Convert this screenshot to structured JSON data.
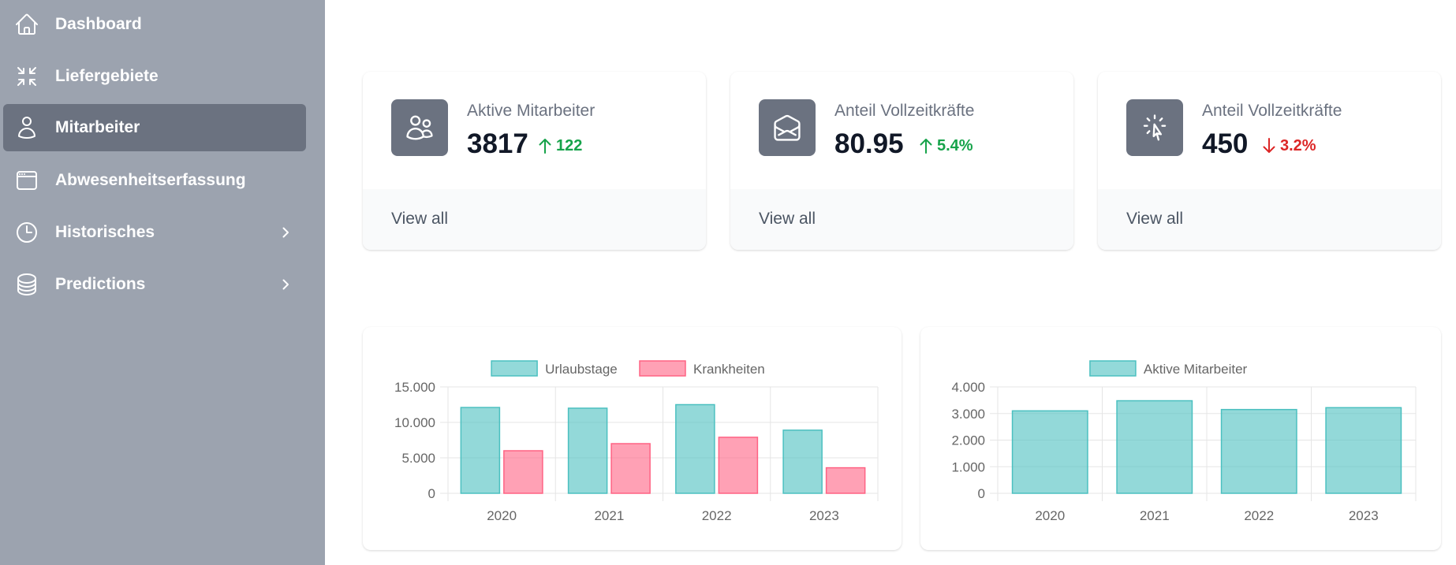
{
  "sidebar": {
    "items": [
      {
        "label": "Dashboard",
        "icon": "home-icon",
        "active": false,
        "chevron": false
      },
      {
        "label": "Liefergebiete",
        "icon": "arrows-pointing-in-icon",
        "active": false,
        "chevron": false
      },
      {
        "label": "Mitarbeiter",
        "icon": "user-icon",
        "active": true,
        "chevron": false
      },
      {
        "label": "Abwesenheitserfassung",
        "icon": "window-icon",
        "active": false,
        "chevron": false
      },
      {
        "label": "Historisches",
        "icon": "clock-icon",
        "active": false,
        "chevron": true
      },
      {
        "label": "Predictions",
        "icon": "database-icon",
        "active": false,
        "chevron": true
      }
    ]
  },
  "stats": [
    {
      "title": "Aktive Mitarbeiter",
      "value": "3817",
      "change": "122",
      "direction": "up",
      "icon": "users-icon",
      "footer": "View all"
    },
    {
      "title": "Anteil Vollzeitkräfte",
      "value": "80.95",
      "change": "5.4%",
      "direction": "up",
      "icon": "envelope-open-icon",
      "footer": "View all"
    },
    {
      "title": "Anteil Vollzeitkräfte",
      "value": "450",
      "change": "3.2%",
      "direction": "down",
      "icon": "cursor-click-icon",
      "footer": "View all"
    }
  ],
  "colors": {
    "sidebar_bg": "#9ca3af",
    "sidebar_active": "#6b7280",
    "up": "#16a34a",
    "down": "#dc2626",
    "series_teal": "#4bc0c0",
    "series_pink": "#ff6384"
  },
  "chart_data": [
    {
      "type": "bar",
      "categories": [
        "2020",
        "2021",
        "2022",
        "2023"
      ],
      "series": [
        {
          "name": "Urlaubstage",
          "values": [
            12100,
            12000,
            12500,
            8900
          ]
        },
        {
          "name": "Krankheiten",
          "values": [
            6000,
            7000,
            7900,
            3600
          ]
        }
      ],
      "yticks": [
        "0",
        "5.000",
        "10.000",
        "15.000"
      ],
      "ylim": [
        0,
        15000
      ],
      "grid": true,
      "legend": "top"
    },
    {
      "type": "bar",
      "categories": [
        "2020",
        "2021",
        "2022",
        "2023"
      ],
      "series": [
        {
          "name": "Aktive Mitarbeiter",
          "values": [
            3100,
            3480,
            3150,
            3220
          ]
        }
      ],
      "yticks": [
        "0",
        "1.000",
        "2.000",
        "3.000",
        "4.000"
      ],
      "ylim": [
        0,
        4000
      ],
      "grid": true,
      "legend": "top"
    }
  ]
}
